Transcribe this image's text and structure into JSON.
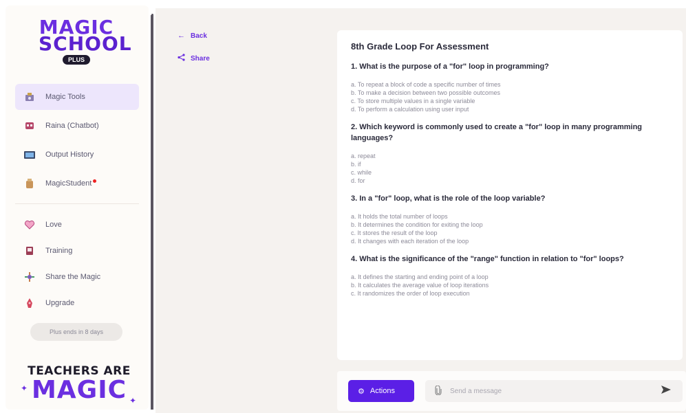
{
  "sidebar": {
    "logo": {
      "line1": "MAGIC",
      "line2": "SCHOOL",
      "badge": "PLUS"
    },
    "nav_items": [
      {
        "label": "Magic Tools",
        "icon": "magic-tools-icon",
        "active": true
      },
      {
        "label": "Raina (Chatbot)",
        "icon": "chatbot-icon"
      },
      {
        "label": "Output History",
        "icon": "output-history-icon"
      },
      {
        "label": "MagicStudent",
        "icon": "magic-student-icon",
        "notification": true
      }
    ],
    "secondary_items": [
      {
        "label": "Love",
        "icon": "heart-icon"
      },
      {
        "label": "Training",
        "icon": "training-icon"
      },
      {
        "label": "Share the Magic",
        "icon": "share-magic-icon"
      },
      {
        "label": "Upgrade",
        "icon": "upgrade-icon"
      }
    ],
    "plan_status": "Plus ends in 8 days",
    "tagline": {
      "top": "TEACHERS ARE",
      "bottom": "MAGIC"
    }
  },
  "toolbar": {
    "back_label": "Back",
    "share_label": "Share"
  },
  "document": {
    "title": "8th Grade Loop For Assessment",
    "questions": [
      {
        "text": "1. What is the purpose of a \"for\" loop in programming?",
        "options": [
          "a. To repeat a block of code a specific number of times",
          "b. To make a decision between two possible outcomes",
          "c. To store multiple values in a single variable",
          "d. To perform a calculation using user input"
        ]
      },
      {
        "text": "2. Which keyword is commonly used to create a \"for\" loop in many programming languages?",
        "options": [
          "a. repeat",
          "b. if",
          "c. while",
          "d. for"
        ]
      },
      {
        "text": "3. In a \"for\" loop, what is the role of the loop variable?",
        "options": [
          "a. It holds the total number of loops",
          "b. It determines the condition for exiting the loop",
          "c. It stores the result of the loop",
          "d. It changes with each iteration of the loop"
        ]
      },
      {
        "text": "4. What is the significance of the \"range\" function in relation to \"for\" loops?",
        "options": [
          "a. It defines the starting and ending point of a loop",
          "b. It calculates the average value of loop iterations",
          "c. It randomizes the order of loop execution"
        ]
      }
    ]
  },
  "composer": {
    "actions_label": "Actions",
    "placeholder": "Send a message"
  },
  "colors": {
    "accent": "#5b1fe6",
    "brand": "#6b2fe0",
    "active_nav": "#ede6fc"
  }
}
